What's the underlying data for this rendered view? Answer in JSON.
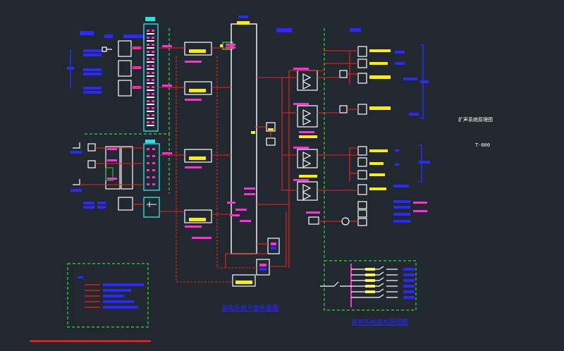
{
  "diagram": {
    "title_text": "T-000",
    "drawing_note": "扩声系统原理图",
    "scheme_label": "音响系统平面布置图",
    "lower_caption": "音响系统接线原理图",
    "colors": {
      "background": "#212830",
      "wire": "#ff1c1c",
      "magenta": "#ff2fd8",
      "yellow": "#ffee00",
      "white": "#ffffff",
      "cyan": "#27e0e6",
      "green": "#33cc33",
      "blue": "#2a2aff",
      "dashed_green": "#33dd33"
    }
  }
}
